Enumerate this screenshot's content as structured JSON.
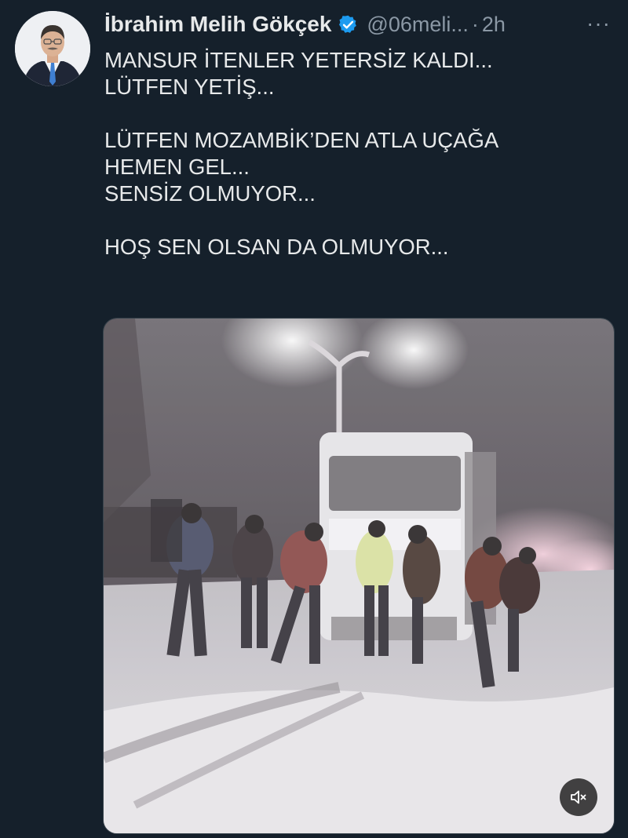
{
  "tweet": {
    "author_name": "İbrahim Melih Gökçek",
    "handle": "@06meli...",
    "separator": "·",
    "time": "2h",
    "more": "···",
    "lines": [
      "MANSUR İTENLER YETERSİZ KALDI...",
      "LÜTFEN YETİŞ...",
      "",
      "LÜTFEN MOZAMBİK’DEN ATLA UÇAĞA",
      "HEMEN GEL...",
      "SENSİZ OLMUYOR...",
      "",
      "HOŞ SEN OLSAN DA OLMUYOR..."
    ]
  },
  "icons": {
    "verified": "verified-badge-icon",
    "more": "more-options-icon",
    "mute": "speaker-muted-icon"
  },
  "colors": {
    "background": "#15202b",
    "text": "#e7e9ea",
    "secondary": "#8b98a5",
    "verified": "#1d9bf0"
  }
}
